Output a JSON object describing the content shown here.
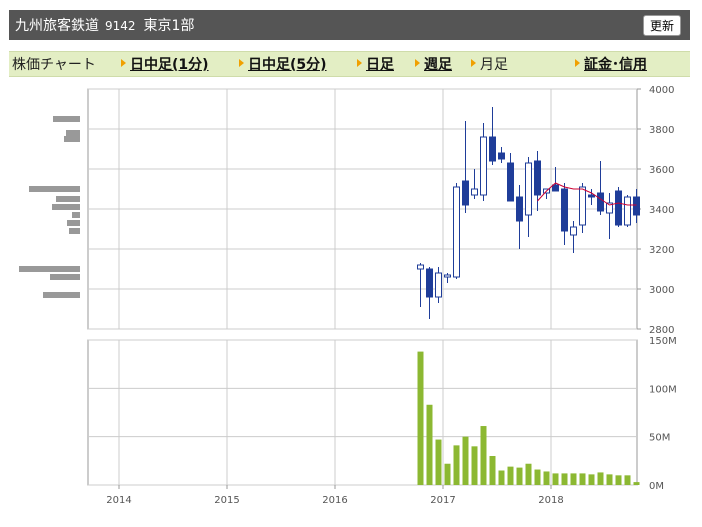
{
  "header": {
    "company": "九州旅客鉄道",
    "code": "9142",
    "market": "東京1部",
    "refresh": "更新"
  },
  "nav": {
    "label": "株価チャート",
    "items": [
      "日中足(1分)",
      "日中足(5分)",
      "日足",
      "週足",
      "月足",
      "証金･信用"
    ]
  },
  "colors": {
    "down": "#1f3d99",
    "up": "#ffffff",
    "ma": "#cc0033",
    "volume": "#8cb832",
    "profile": "#999999",
    "grid": "#cccccc"
  },
  "chart_data": [
    {
      "type": "candlestick",
      "title": "",
      "ylim": [
        2800,
        4000
      ],
      "yticks": [
        2800,
        3000,
        3200,
        3400,
        3600,
        3800,
        4000
      ],
      "xticks": [
        "2014",
        "2015",
        "2016",
        "2017",
        "2018"
      ],
      "grid": true,
      "series": [
        {
          "date": "2016-10",
          "open": 3100,
          "high": 3130,
          "low": 2910,
          "close": 3120
        },
        {
          "date": "2016-11",
          "open": 3100,
          "high": 3110,
          "low": 2850,
          "close": 2960
        },
        {
          "date": "2016-12",
          "open": 2960,
          "high": 3110,
          "low": 2930,
          "close": 3080
        },
        {
          "date": "2017-01",
          "open": 3060,
          "high": 3080,
          "low": 3030,
          "close": 3070
        },
        {
          "date": "2017-02",
          "open": 3060,
          "high": 3530,
          "low": 3050,
          "close": 3510
        },
        {
          "date": "2017-03",
          "open": 3540,
          "high": 3840,
          "low": 3380,
          "close": 3420
        },
        {
          "date": "2017-04",
          "open": 3470,
          "high": 3600,
          "low": 3450,
          "close": 3500
        },
        {
          "date": "2017-05",
          "open": 3470,
          "high": 3830,
          "low": 3440,
          "close": 3760
        },
        {
          "date": "2017-06",
          "open": 3760,
          "high": 3910,
          "low": 3620,
          "close": 3640
        },
        {
          "date": "2017-07",
          "open": 3680,
          "high": 3710,
          "low": 3630,
          "close": 3650
        },
        {
          "date": "2017-08",
          "open": 3630,
          "high": 3680,
          "low": 3450,
          "close": 3440
        },
        {
          "date": "2017-09",
          "open": 3460,
          "high": 3520,
          "low": 3200,
          "close": 3340
        },
        {
          "date": "2017-10",
          "open": 3370,
          "high": 3660,
          "low": 3260,
          "close": 3630
        },
        {
          "date": "2017-11",
          "open": 3640,
          "high": 3690,
          "low": 3390,
          "close": 3470
        },
        {
          "date": "2017-12",
          "open": 3480,
          "high": 3500,
          "low": 3450,
          "close": 3500
        },
        {
          "date": "2018-01",
          "open": 3520,
          "high": 3610,
          "low": 3490,
          "close": 3490
        },
        {
          "date": "2018-02",
          "open": 3500,
          "high": 3530,
          "low": 3220,
          "close": 3290
        },
        {
          "date": "2018-03",
          "open": 3270,
          "high": 3340,
          "low": 3180,
          "close": 3310
        },
        {
          "date": "2018-04",
          "open": 3320,
          "high": 3530,
          "low": 3280,
          "close": 3510
        },
        {
          "date": "2018-05",
          "open": 3470,
          "high": 3500,
          "low": 3420,
          "close": 3460
        },
        {
          "date": "2018-06",
          "open": 3480,
          "high": 3640,
          "low": 3370,
          "close": 3390
        },
        {
          "date": "2018-07",
          "open": 3380,
          "high": 3480,
          "low": 3250,
          "close": 3430
        },
        {
          "date": "2018-08",
          "open": 3490,
          "high": 3510,
          "low": 3310,
          "close": 3320
        },
        {
          "date": "2018-09",
          "open": 3320,
          "high": 3470,
          "low": 3310,
          "close": 3460
        },
        {
          "date": "2018-10",
          "open": 3460,
          "high": 3500,
          "low": 3330,
          "close": 3370
        }
      ],
      "moving_average": [
        {
          "date": "2017-11",
          "value": 3440
        },
        {
          "date": "2017-12",
          "value": 3490
        },
        {
          "date": "2018-01",
          "value": 3530
        },
        {
          "date": "2018-02",
          "value": 3510
        },
        {
          "date": "2018-03",
          "value": 3500
        },
        {
          "date": "2018-04",
          "value": 3500
        },
        {
          "date": "2018-05",
          "value": 3480
        },
        {
          "date": "2018-06",
          "value": 3450
        },
        {
          "date": "2018-07",
          "value": 3420
        },
        {
          "date": "2018-08",
          "value": 3430
        },
        {
          "date": "2018-09",
          "value": 3420
        },
        {
          "date": "2018-10",
          "value": 3420
        }
      ],
      "price_volume_profile": [
        {
          "price": 3850,
          "width": 27
        },
        {
          "price": 3780,
          "width": 14
        },
        {
          "price": 3750,
          "width": 16
        },
        {
          "price": 3500,
          "width": 51
        },
        {
          "price": 3450,
          "width": 24
        },
        {
          "price": 3410,
          "width": 28
        },
        {
          "price": 3370,
          "width": 8
        },
        {
          "price": 3330,
          "width": 13
        },
        {
          "price": 3290,
          "width": 11
        },
        {
          "price": 3100,
          "width": 61
        },
        {
          "price": 3060,
          "width": 30
        },
        {
          "price": 2970,
          "width": 37
        }
      ]
    },
    {
      "type": "bar",
      "title": "",
      "ylim": [
        0,
        150
      ],
      "yticks": [
        "0M",
        "50M",
        "100M",
        "150M"
      ],
      "categories": [
        "2016-10",
        "2016-11",
        "2016-12",
        "2017-01",
        "2017-02",
        "2017-03",
        "2017-04",
        "2017-05",
        "2017-06",
        "2017-07",
        "2017-08",
        "2017-09",
        "2017-10",
        "2017-11",
        "2017-12",
        "2018-01",
        "2018-02",
        "2018-03",
        "2018-04",
        "2018-05",
        "2018-06",
        "2018-07",
        "2018-08",
        "2018-09",
        "2018-10"
      ],
      "values": [
        138,
        83,
        47,
        22,
        41,
        50,
        40,
        61,
        30,
        15,
        19,
        18,
        22,
        16,
        14,
        12,
        12,
        12,
        12,
        11,
        13,
        11,
        10,
        10,
        3
      ]
    }
  ]
}
